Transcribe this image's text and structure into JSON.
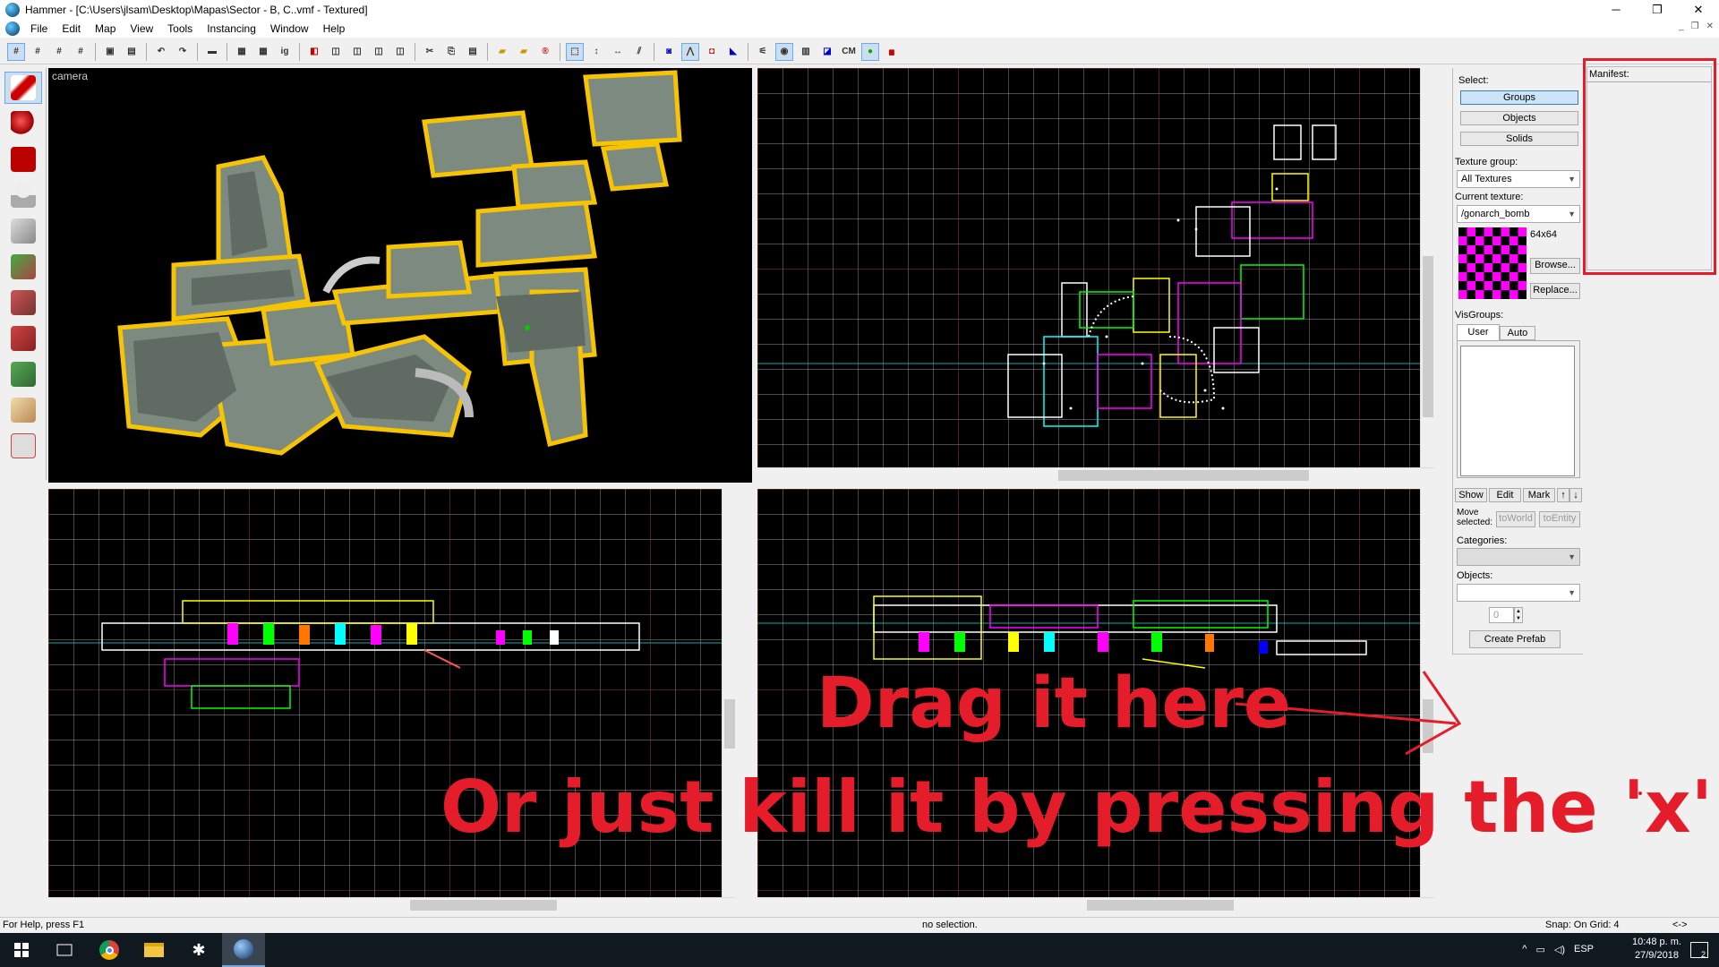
{
  "window": {
    "title": "Hammer - [C:\\Users\\jlsam\\Desktop\\Mapas\\Sector - B, C..vmf - Textured]",
    "controls": [
      "─",
      "❐",
      "✕"
    ]
  },
  "menu": [
    "File",
    "Edit",
    "Map",
    "View",
    "Tools",
    "Instancing",
    "Window",
    "Help"
  ],
  "mdi_controls": [
    "_",
    "❐",
    "✕"
  ],
  "toolbar": {
    "cm_label": "CM"
  },
  "viewports": {
    "camera_label": "camera"
  },
  "panel": {
    "select_label": "Select:",
    "select_buttons": [
      "Groups",
      "Objects",
      "Solids"
    ],
    "texture_group_label": "Texture group:",
    "texture_group_value": "All Textures",
    "current_texture_label": "Current texture:",
    "current_texture_value": "/gonarch_bomb",
    "texture_size": "64x64",
    "browse_label": "Browse...",
    "replace_label": "Replace...",
    "visgroups_label": "VisGroups:",
    "visgroup_tabs": [
      "User",
      "Auto"
    ],
    "visgroup_buttons": [
      "Show",
      "Edit",
      "Mark"
    ],
    "move_selected_label_1": "Move",
    "move_selected_label_2": "selected:",
    "to_world_label": "toWorld",
    "to_entity_label": "toEntity",
    "categories_label": "Categories:",
    "objects_label": "Objects:",
    "objects_count": "0",
    "create_prefab_label": "Create Prefab"
  },
  "manifest": {
    "label": "Manifest:"
  },
  "status": {
    "help": "For Help, press F1",
    "selection": "no selection.",
    "snap": "Snap: On Grid: 4",
    "arrows": "<->"
  },
  "taskbar": {
    "lang": "ESP",
    "time": "10:48 p. m.",
    "date": "27/9/2018",
    "notif_count": "2"
  },
  "annotations": {
    "drag": "Drag it here",
    "kill": "Or just kill it by pressing the 'x'"
  },
  "colors": {
    "annotation_red": "#e51c2a",
    "missing_texture_magenta": "#ff00ff",
    "grid_orange": "#8a4a1c",
    "grid_white": "#c8c8c8"
  }
}
